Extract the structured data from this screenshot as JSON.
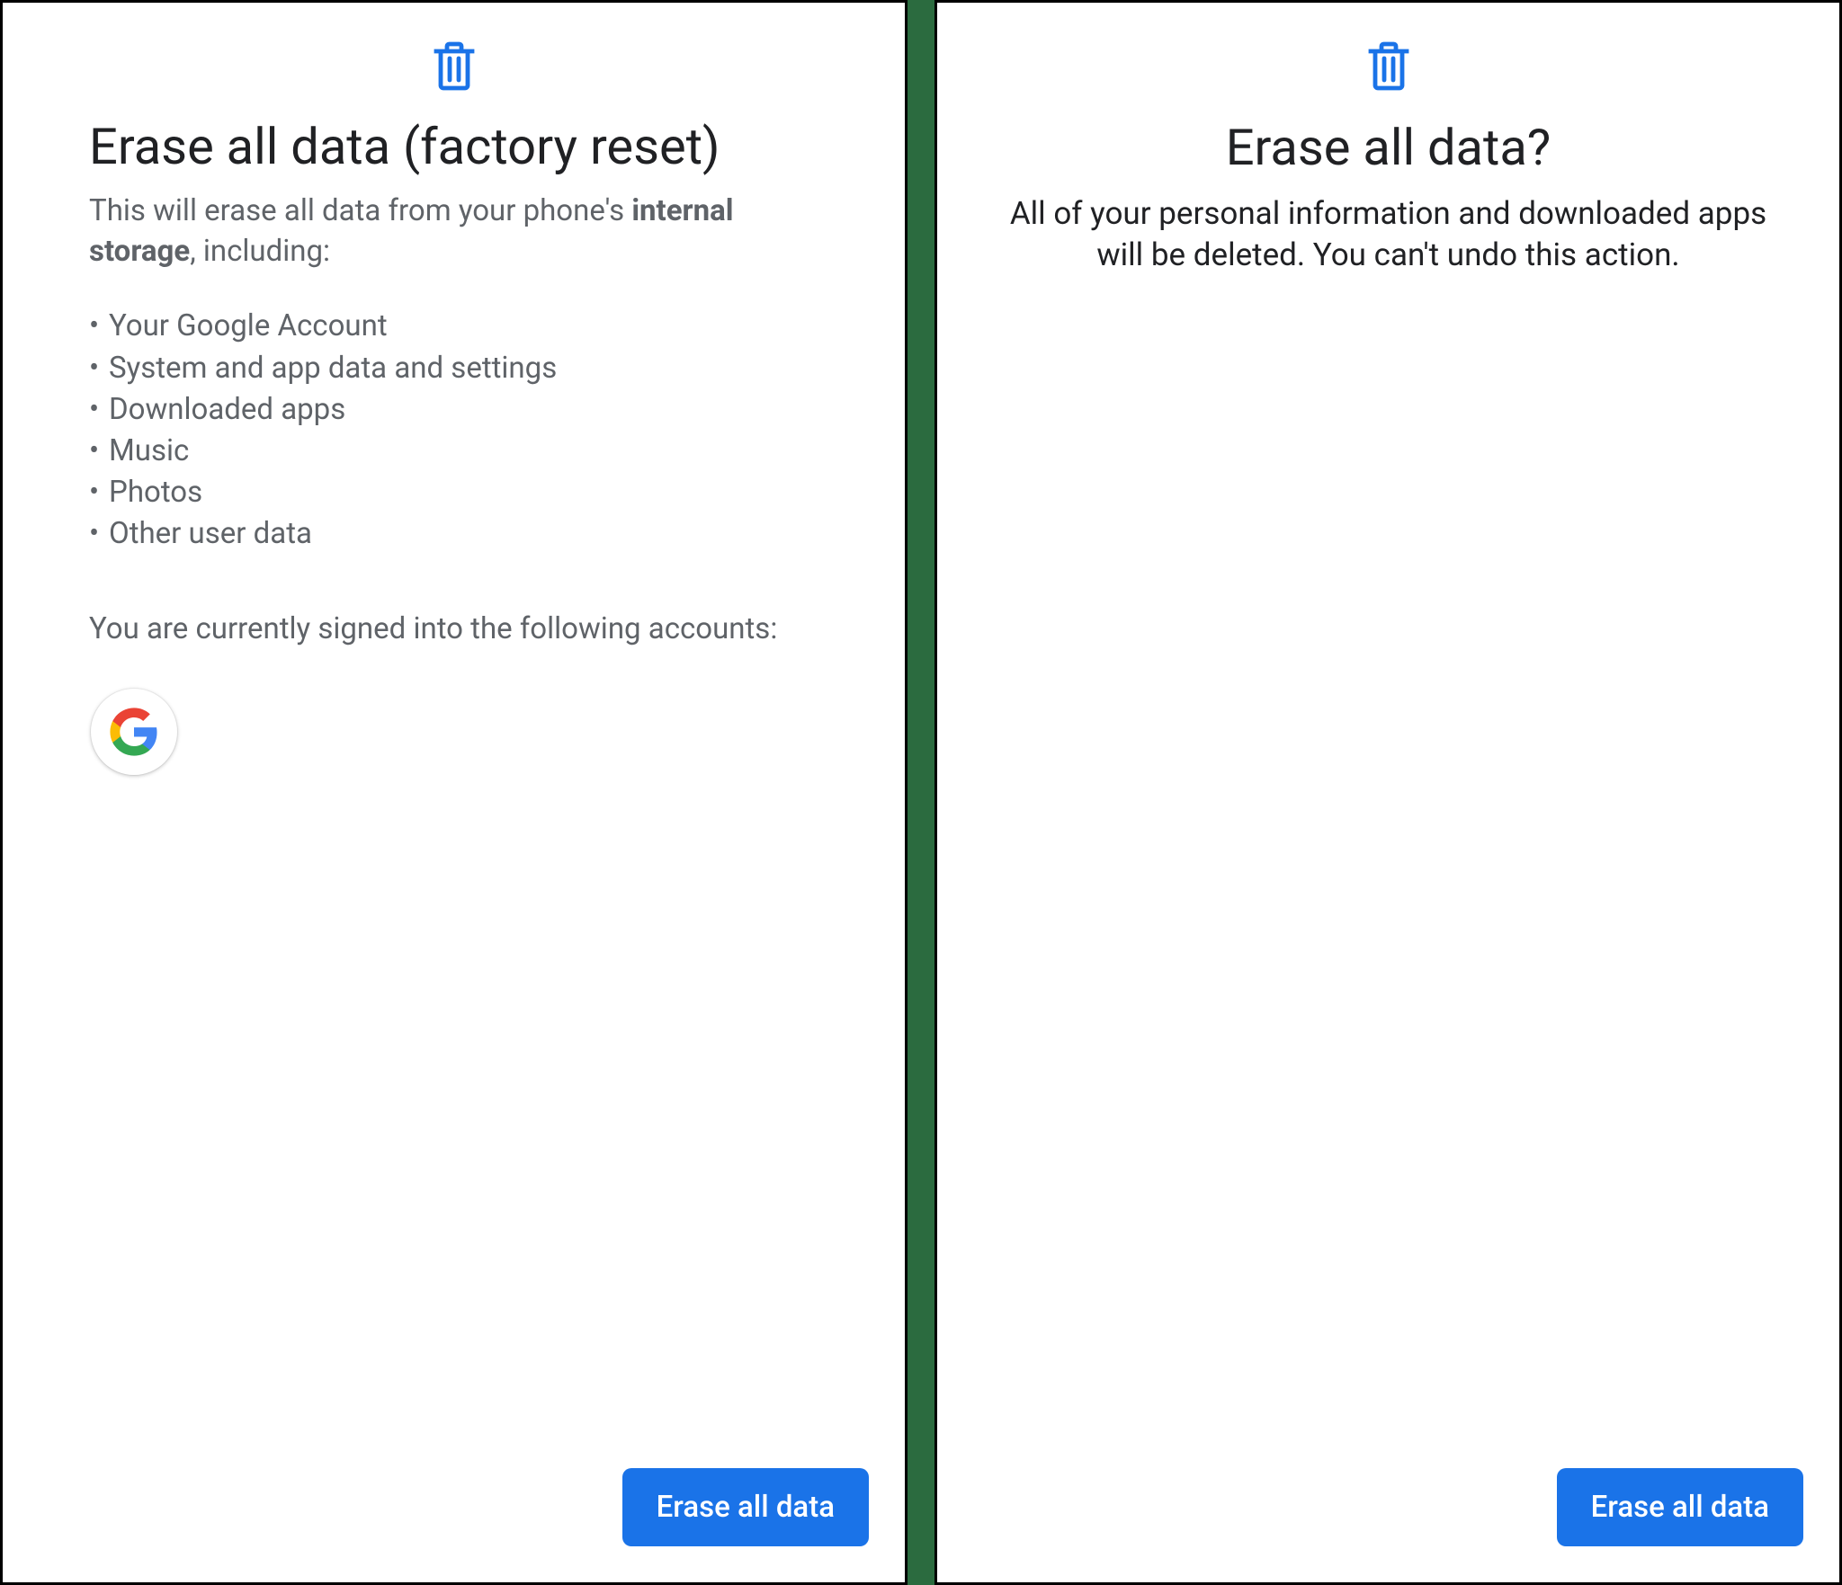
{
  "colors": {
    "accent": "#1a73e8",
    "icon": "#1a73e8",
    "text_primary": "#202124",
    "text_secondary": "#5f6368"
  },
  "screen1": {
    "title": "Erase all data (factory reset)",
    "subtitle_pre": "This will erase all data from your phone's ",
    "subtitle_bold": "internal storage",
    "subtitle_post": ", including:",
    "bullets": [
      "Your Google Account",
      "System and app data and settings",
      "Downloaded apps",
      "Music",
      "Photos",
      "Other user data"
    ],
    "signed_in_text": "You are currently signed into the following accounts:",
    "account_icon": "google-logo",
    "button_label": "Erase all data"
  },
  "screen2": {
    "title": "Erase all data?",
    "description": "All of your personal information and downloaded apps will be deleted. You can't undo this action.",
    "button_label": "Erase all data"
  }
}
